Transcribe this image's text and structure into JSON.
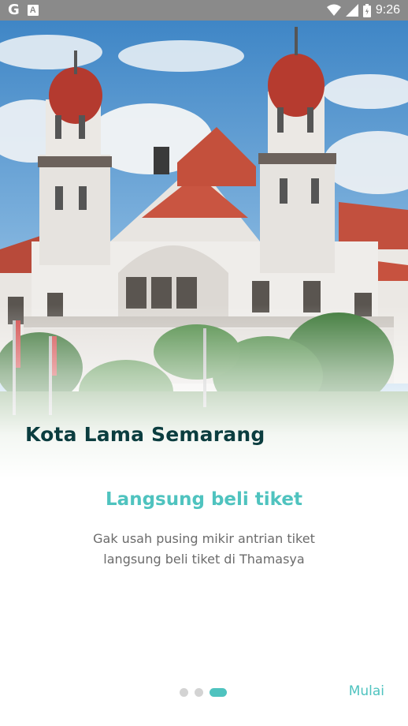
{
  "status_bar": {
    "left_icons": [
      "google-icon",
      "a-notification-icon"
    ],
    "google_glyph": "G",
    "a_glyph": "A",
    "right_icons": [
      "wifi-icon",
      "signal-icon",
      "battery-icon"
    ],
    "time": "9:26"
  },
  "hero": {
    "image": "kota-lama-semarang-building-photo",
    "title": "Kota Lama Semarang"
  },
  "slide": {
    "title": "Langsung beli tiket",
    "description": "Gak usah pusing mikir antrian tiket langsung beli tiket di Thamasya"
  },
  "pager": {
    "total": 3,
    "active_index": 2
  },
  "next_button": {
    "label": "Mulai"
  },
  "colors": {
    "accent": "#4fc3bf",
    "title_dark": "#0b3d3f",
    "body_text": "#6b6b6b",
    "dot_inactive": "#d3d3d3",
    "status_bar": "#8a8a8a"
  }
}
